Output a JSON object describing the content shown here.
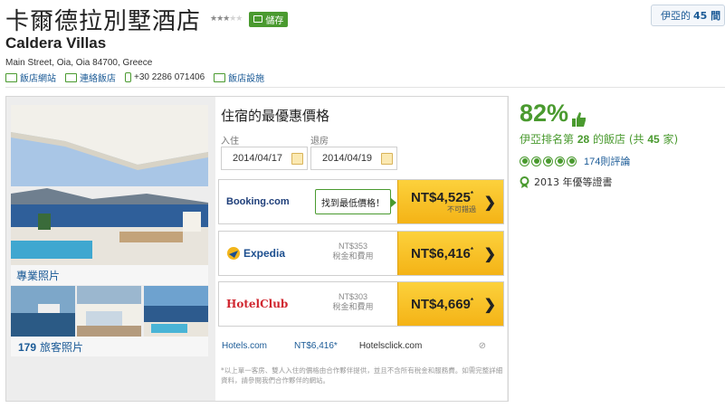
{
  "header": {
    "name_zh": "卡爾德拉別墅酒店",
    "name_en": "Caldera Villas",
    "star_rating": 3,
    "star_max": 5,
    "save_label": "儲存",
    "address": "Main Street, Oia, Oia 84700, Greece",
    "links": {
      "website": "飯店網站",
      "email": "連絡飯店",
      "phone": "+30 2286 071406",
      "amenities": "飯店設施"
    },
    "top_right_prefix": "伊亞的",
    "top_right_count": "45 間"
  },
  "photos": {
    "professional_label": "專業照片",
    "traveler_count": "179",
    "traveler_label": "旅客照片"
  },
  "deals": {
    "title": "住宿的最優惠價格",
    "checkin_label": "入住",
    "checkout_label": "退房",
    "checkin": "2014/04/17",
    "checkout": "2014/04/19",
    "offers": [
      {
        "provider": "Booking.com",
        "tag": "找到最低價格！",
        "price": "NT$4,525",
        "note": "不可錯過",
        "fee_price": "",
        "fee_label": ""
      },
      {
        "provider": "Expedia",
        "tag": "",
        "price": "NT$6,416",
        "note": "",
        "fee_price": "NT$353",
        "fee_label": "稅金和費用"
      },
      {
        "provider": "HotelClub",
        "tag": "",
        "price": "NT$4,669",
        "note": "",
        "fee_price": "NT$303",
        "fee_label": "稅金和費用"
      }
    ],
    "other": {
      "site1": "Hotels.com",
      "price1": "NT$6,416*",
      "site2": "Hotelsclick.com"
    },
    "disclaimer": "*以上單一客房、雙人入住的價格由合作夥伴提供，並且不含所有稅金和服務費。如需完整詳細資料，請參閱我們合作夥伴的網站。"
  },
  "rating": {
    "percent": "82%",
    "rank_prefix": "伊亞排名第",
    "rank": "28",
    "rank_mid": "的飯店 (共",
    "rank_total": "45",
    "rank_suffix": "家)",
    "bubble_score": 5,
    "review_count": "174",
    "review_label": "則評論",
    "award": "2013 年優等證書"
  },
  "colors": {
    "brand_green": "#4a9a2f",
    "link_blue": "#1a5a96",
    "cta_yellow": "#f4b316"
  }
}
